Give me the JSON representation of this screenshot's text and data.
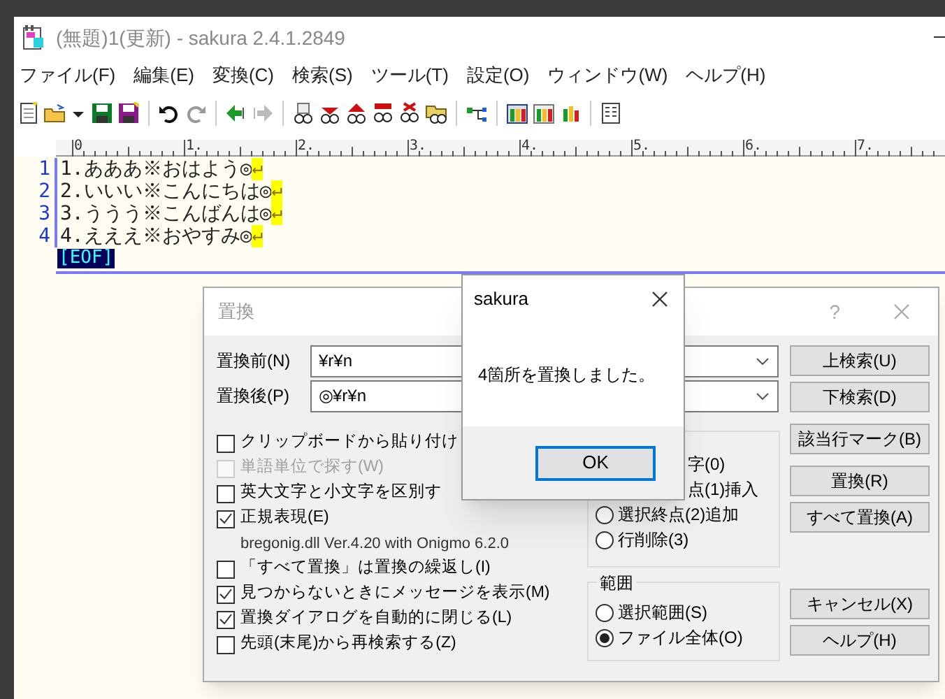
{
  "window": {
    "title": "(無題)1(更新) - sakura 2.4.1.2849"
  },
  "menu": [
    "ファイル(F)",
    "編集(E)",
    "変換(C)",
    "検索(S)",
    "ツール(T)",
    "設定(O)",
    "ウィンドウ(W)",
    "ヘルプ(H)"
  ],
  "ruler": [
    "0",
    "1.",
    "2.",
    "3.",
    "4.",
    "5.",
    "6.",
    "7."
  ],
  "editor": {
    "lines": [
      {
        "number": "1",
        "text": "1.あああ※おはよう◎",
        "eol": "↵"
      },
      {
        "number": "2",
        "text": "2.いいい※こんにちは◎",
        "eol": "↵"
      },
      {
        "number": "3",
        "text": "3.ううう※こんばんは◎",
        "eol": "↵"
      },
      {
        "number": "4",
        "text": "4.えええ※おやすみ◎",
        "eol": "↵"
      }
    ],
    "eof": "[EOF]"
  },
  "replace_dialog": {
    "title": "置換",
    "help": "?",
    "before": {
      "label": "置換前(N)",
      "value": "¥r¥n"
    },
    "after": {
      "label": "置換後(P)",
      "value": "◎¥r¥n"
    },
    "options": [
      {
        "kind": "checkbox",
        "label": "クリップボードから貼り付け",
        "checked": false,
        "disabled": false
      },
      {
        "kind": "checkbox",
        "label": "単語単位で探す(W)",
        "checked": false,
        "disabled": true
      },
      {
        "kind": "checkbox",
        "label": "英大文字と小文字を区別す",
        "checked": false,
        "disabled": false
      },
      {
        "kind": "checkbox",
        "label": "正規表現(E)",
        "checked": true,
        "disabled": false
      },
      {
        "kind": "note",
        "label": "bregonig.dll Ver.4.20 with Onigmo 6.2.0"
      },
      {
        "kind": "checkbox",
        "label": "「すべて置換」は置換の繰返し(I)",
        "checked": false,
        "disabled": false
      },
      {
        "kind": "checkbox",
        "label": "見つからないときにメッセージを表示(M)",
        "checked": true,
        "disabled": false
      },
      {
        "kind": "checkbox",
        "label": "置換ダイアログを自動的に閉じる(L)",
        "checked": true,
        "disabled": false
      },
      {
        "kind": "checkbox",
        "label": "先頭(末尾)から再検索する(Z)",
        "checked": false,
        "disabled": false
      }
    ],
    "mode_group": {
      "options": [
        {
          "kind": "covered",
          "label": "字(0)"
        },
        {
          "kind": "covered",
          "label": "点(1)挿入"
        },
        {
          "kind": "radio",
          "label": "選択終点(2)追加",
          "selected": false
        },
        {
          "kind": "radio",
          "label": "行削除(3)",
          "selected": false
        }
      ]
    },
    "range_group": {
      "title": "範囲",
      "options": [
        {
          "kind": "radio",
          "label": "選択範囲(S)",
          "selected": false
        },
        {
          "kind": "radio",
          "label": "ファイル全体(O)",
          "selected": true
        }
      ]
    },
    "buttons": [
      {
        "label": "上検索(U)"
      },
      {
        "label": "下検索(D)"
      },
      {
        "label": "該当行マーク(B)"
      },
      {
        "label": "置換(R)"
      },
      {
        "label": "すべて置換(A)"
      },
      {
        "label": "キャンセル(X)"
      },
      {
        "label": "ヘルプ(H)"
      }
    ]
  },
  "message_box": {
    "title": "sakura",
    "message": "4箇所を置換しました。",
    "button": "OK"
  }
}
